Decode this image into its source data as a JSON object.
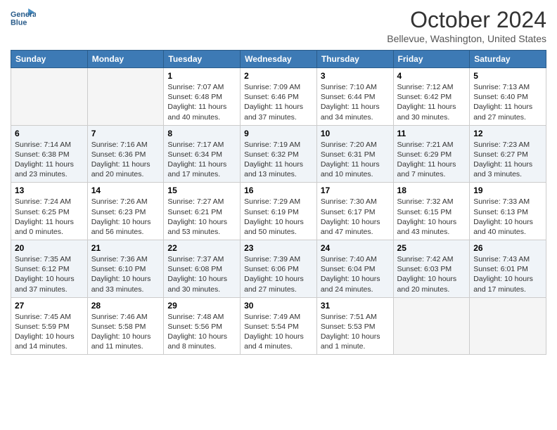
{
  "logo": {
    "line1": "General",
    "line2": "Blue"
  },
  "title": "October 2024",
  "subtitle": "Bellevue, Washington, United States",
  "headers": [
    "Sunday",
    "Monday",
    "Tuesday",
    "Wednesday",
    "Thursday",
    "Friday",
    "Saturday"
  ],
  "weeks": [
    [
      {
        "day": "",
        "empty": true
      },
      {
        "day": "",
        "empty": true
      },
      {
        "day": "1",
        "sunrise": "Sunrise: 7:07 AM",
        "sunset": "Sunset: 6:48 PM",
        "daylight": "Daylight: 11 hours and 40 minutes."
      },
      {
        "day": "2",
        "sunrise": "Sunrise: 7:09 AM",
        "sunset": "Sunset: 6:46 PM",
        "daylight": "Daylight: 11 hours and 37 minutes."
      },
      {
        "day": "3",
        "sunrise": "Sunrise: 7:10 AM",
        "sunset": "Sunset: 6:44 PM",
        "daylight": "Daylight: 11 hours and 34 minutes."
      },
      {
        "day": "4",
        "sunrise": "Sunrise: 7:12 AM",
        "sunset": "Sunset: 6:42 PM",
        "daylight": "Daylight: 11 hours and 30 minutes."
      },
      {
        "day": "5",
        "sunrise": "Sunrise: 7:13 AM",
        "sunset": "Sunset: 6:40 PM",
        "daylight": "Daylight: 11 hours and 27 minutes."
      }
    ],
    [
      {
        "day": "6",
        "sunrise": "Sunrise: 7:14 AM",
        "sunset": "Sunset: 6:38 PM",
        "daylight": "Daylight: 11 hours and 23 minutes."
      },
      {
        "day": "7",
        "sunrise": "Sunrise: 7:16 AM",
        "sunset": "Sunset: 6:36 PM",
        "daylight": "Daylight: 11 hours and 20 minutes."
      },
      {
        "day": "8",
        "sunrise": "Sunrise: 7:17 AM",
        "sunset": "Sunset: 6:34 PM",
        "daylight": "Daylight: 11 hours and 17 minutes."
      },
      {
        "day": "9",
        "sunrise": "Sunrise: 7:19 AM",
        "sunset": "Sunset: 6:32 PM",
        "daylight": "Daylight: 11 hours and 13 minutes."
      },
      {
        "day": "10",
        "sunrise": "Sunrise: 7:20 AM",
        "sunset": "Sunset: 6:31 PM",
        "daylight": "Daylight: 11 hours and 10 minutes."
      },
      {
        "day": "11",
        "sunrise": "Sunrise: 7:21 AM",
        "sunset": "Sunset: 6:29 PM",
        "daylight": "Daylight: 11 hours and 7 minutes."
      },
      {
        "day": "12",
        "sunrise": "Sunrise: 7:23 AM",
        "sunset": "Sunset: 6:27 PM",
        "daylight": "Daylight: 11 hours and 3 minutes."
      }
    ],
    [
      {
        "day": "13",
        "sunrise": "Sunrise: 7:24 AM",
        "sunset": "Sunset: 6:25 PM",
        "daylight": "Daylight: 11 hours and 0 minutes."
      },
      {
        "day": "14",
        "sunrise": "Sunrise: 7:26 AM",
        "sunset": "Sunset: 6:23 PM",
        "daylight": "Daylight: 10 hours and 56 minutes."
      },
      {
        "day": "15",
        "sunrise": "Sunrise: 7:27 AM",
        "sunset": "Sunset: 6:21 PM",
        "daylight": "Daylight: 10 hours and 53 minutes."
      },
      {
        "day": "16",
        "sunrise": "Sunrise: 7:29 AM",
        "sunset": "Sunset: 6:19 PM",
        "daylight": "Daylight: 10 hours and 50 minutes."
      },
      {
        "day": "17",
        "sunrise": "Sunrise: 7:30 AM",
        "sunset": "Sunset: 6:17 PM",
        "daylight": "Daylight: 10 hours and 47 minutes."
      },
      {
        "day": "18",
        "sunrise": "Sunrise: 7:32 AM",
        "sunset": "Sunset: 6:15 PM",
        "daylight": "Daylight: 10 hours and 43 minutes."
      },
      {
        "day": "19",
        "sunrise": "Sunrise: 7:33 AM",
        "sunset": "Sunset: 6:13 PM",
        "daylight": "Daylight: 10 hours and 40 minutes."
      }
    ],
    [
      {
        "day": "20",
        "sunrise": "Sunrise: 7:35 AM",
        "sunset": "Sunset: 6:12 PM",
        "daylight": "Daylight: 10 hours and 37 minutes."
      },
      {
        "day": "21",
        "sunrise": "Sunrise: 7:36 AM",
        "sunset": "Sunset: 6:10 PM",
        "daylight": "Daylight: 10 hours and 33 minutes."
      },
      {
        "day": "22",
        "sunrise": "Sunrise: 7:37 AM",
        "sunset": "Sunset: 6:08 PM",
        "daylight": "Daylight: 10 hours and 30 minutes."
      },
      {
        "day": "23",
        "sunrise": "Sunrise: 7:39 AM",
        "sunset": "Sunset: 6:06 PM",
        "daylight": "Daylight: 10 hours and 27 minutes."
      },
      {
        "day": "24",
        "sunrise": "Sunrise: 7:40 AM",
        "sunset": "Sunset: 6:04 PM",
        "daylight": "Daylight: 10 hours and 24 minutes."
      },
      {
        "day": "25",
        "sunrise": "Sunrise: 7:42 AM",
        "sunset": "Sunset: 6:03 PM",
        "daylight": "Daylight: 10 hours and 20 minutes."
      },
      {
        "day": "26",
        "sunrise": "Sunrise: 7:43 AM",
        "sunset": "Sunset: 6:01 PM",
        "daylight": "Daylight: 10 hours and 17 minutes."
      }
    ],
    [
      {
        "day": "27",
        "sunrise": "Sunrise: 7:45 AM",
        "sunset": "Sunset: 5:59 PM",
        "daylight": "Daylight: 10 hours and 14 minutes."
      },
      {
        "day": "28",
        "sunrise": "Sunrise: 7:46 AM",
        "sunset": "Sunset: 5:58 PM",
        "daylight": "Daylight: 10 hours and 11 minutes."
      },
      {
        "day": "29",
        "sunrise": "Sunrise: 7:48 AM",
        "sunset": "Sunset: 5:56 PM",
        "daylight": "Daylight: 10 hours and 8 minutes."
      },
      {
        "day": "30",
        "sunrise": "Sunrise: 7:49 AM",
        "sunset": "Sunset: 5:54 PM",
        "daylight": "Daylight: 10 hours and 4 minutes."
      },
      {
        "day": "31",
        "sunrise": "Sunrise: 7:51 AM",
        "sunset": "Sunset: 5:53 PM",
        "daylight": "Daylight: 10 hours and 1 minute."
      },
      {
        "day": "",
        "empty": true
      },
      {
        "day": "",
        "empty": true
      }
    ]
  ]
}
